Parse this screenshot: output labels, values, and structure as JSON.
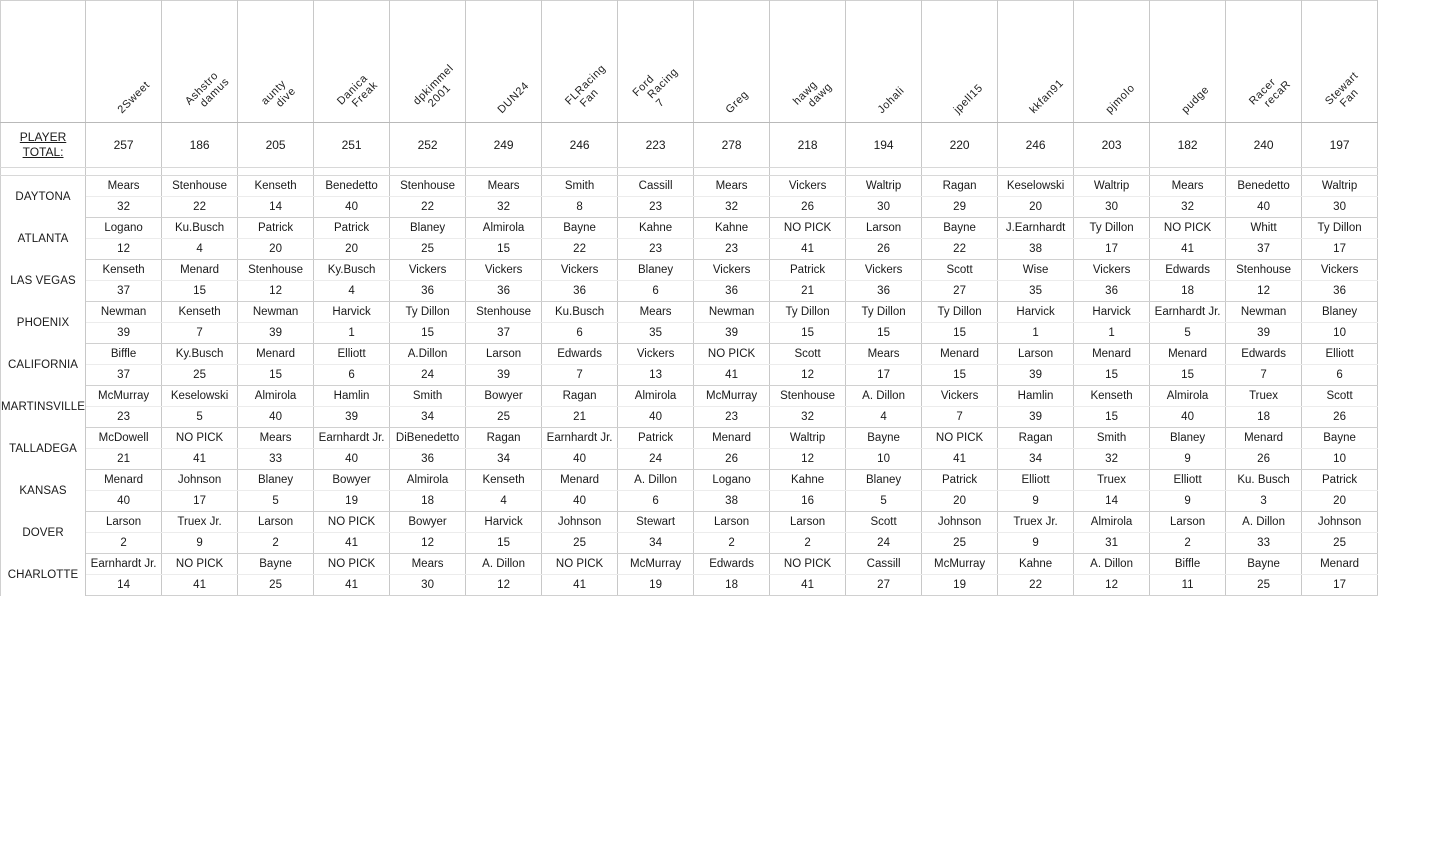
{
  "sheet": {
    "total_row_label": "PLAYER TOTAL:",
    "total_label_line1": "PLAYER",
    "total_label_line2": "TOTAL:",
    "corner_label": ""
  },
  "players": [
    {
      "name": "2Sweet",
      "lines": [
        "2Sweet"
      ],
      "total": "257"
    },
    {
      "name": "Ashstrodamus",
      "lines": [
        "Ashstro",
        "damus"
      ],
      "total": "186"
    },
    {
      "name": "aunty dive",
      "lines": [
        "aunty",
        "dive"
      ],
      "total": "205"
    },
    {
      "name": "Danica Freak",
      "lines": [
        "Danica",
        "Freak"
      ],
      "total": "251"
    },
    {
      "name": "dpkimmel 2001",
      "lines": [
        "dpkimmel",
        "2001"
      ],
      "total": "252"
    },
    {
      "name": "DUN24",
      "lines": [
        "DUN24"
      ],
      "total": "249"
    },
    {
      "name": "FLRacing Fan",
      "lines": [
        "FLRacing",
        "Fan"
      ],
      "total": "246"
    },
    {
      "name": "Ford Racing 7",
      "lines": [
        "Ford",
        "Racing",
        "7"
      ],
      "total": "223"
    },
    {
      "name": "Greg",
      "lines": [
        "Greg"
      ],
      "total": "278"
    },
    {
      "name": "hawg dawg",
      "lines": [
        "hawg",
        "dawg"
      ],
      "total": "218"
    },
    {
      "name": "Johali",
      "lines": [
        "Johali"
      ],
      "total": "194"
    },
    {
      "name": "jpell15",
      "lines": [
        "jpell15"
      ],
      "total": "220"
    },
    {
      "name": "kkfan91",
      "lines": [
        "kkfan91"
      ],
      "total": "246"
    },
    {
      "name": "pjmolo",
      "lines": [
        "pjmolo"
      ],
      "total": "203"
    },
    {
      "name": "pudge",
      "lines": [
        "pudge"
      ],
      "total": "182"
    },
    {
      "name": "Racer recaR",
      "lines": [
        "Racer",
        "recaR"
      ],
      "total": "240"
    },
    {
      "name": "Stewart Fan",
      "lines": [
        "Stewart",
        "Fan"
      ],
      "total": "197"
    }
  ],
  "races": [
    {
      "track": "DAYTONA",
      "picks": [
        "Mears",
        "Stenhouse",
        "Kenseth",
        "Benedetto",
        "Stenhouse",
        "Mears",
        "Smith",
        "Cassill",
        "Mears",
        "Vickers",
        "Waltrip",
        "Ragan",
        "Keselowski",
        "Waltrip",
        "Mears",
        "Benedetto",
        "Waltrip"
      ],
      "points": [
        "32",
        "22",
        "14",
        "40",
        "22",
        "32",
        "8",
        "23",
        "32",
        "26",
        "30",
        "29",
        "20",
        "30",
        "32",
        "40",
        "30"
      ]
    },
    {
      "track": "ATLANTA",
      "picks": [
        "Logano",
        "Ku.Busch",
        "Patrick",
        "Patrick",
        "Blaney",
        "Almirola",
        "Bayne",
        "Kahne",
        "Kahne",
        "NO PICK",
        "Larson",
        "Bayne",
        "J.Earnhardt",
        "Ty Dillon",
        "NO PICK",
        "Whitt",
        "Ty Dillon"
      ],
      "points": [
        "12",
        "4",
        "20",
        "20",
        "25",
        "15",
        "22",
        "23",
        "23",
        "41",
        "26",
        "22",
        "38",
        "17",
        "41",
        "37",
        "17"
      ]
    },
    {
      "track": "LAS VEGAS",
      "picks": [
        "Kenseth",
        "Menard",
        "Stenhouse",
        "Ky.Busch",
        "Vickers",
        "Vickers",
        "Vickers",
        "Blaney",
        "Vickers",
        "Patrick",
        "Vickers",
        "Scott",
        "Wise",
        "Vickers",
        "Edwards",
        "Stenhouse",
        "Vickers"
      ],
      "points": [
        "37",
        "15",
        "12",
        "4",
        "36",
        "36",
        "36",
        "6",
        "36",
        "21",
        "36",
        "27",
        "35",
        "36",
        "18",
        "12",
        "36"
      ]
    },
    {
      "track": "PHOENIX",
      "picks": [
        "Newman",
        "Kenseth",
        "Newman",
        "Harvick",
        "Ty Dillon",
        "Stenhouse",
        "Ku.Busch",
        "Mears",
        "Newman",
        "Ty Dillon",
        "Ty Dillon",
        "Ty Dillon",
        "Harvick",
        "Harvick",
        "Earnhardt Jr.",
        "Newman",
        "Blaney"
      ],
      "points": [
        "39",
        "7",
        "39",
        "1",
        "15",
        "37",
        "6",
        "35",
        "39",
        "15",
        "15",
        "15",
        "1",
        "1",
        "5",
        "39",
        "10"
      ]
    },
    {
      "track": "CALIFORNIA",
      "picks": [
        "Biffle",
        "Ky.Busch",
        "Menard",
        "Elliott",
        "A.Dillon",
        "Larson",
        "Edwards",
        "Vickers",
        "NO PICK",
        "Scott",
        "Mears",
        "Menard",
        "Larson",
        "Menard",
        "Menard",
        "Edwards",
        "Elliott"
      ],
      "points": [
        "37",
        "25",
        "15",
        "6",
        "24",
        "39",
        "7",
        "13",
        "41",
        "12",
        "17",
        "15",
        "39",
        "15",
        "15",
        "7",
        "6"
      ]
    },
    {
      "track": "MARTINSVILLE",
      "picks": [
        "McMurray",
        "Keselowski",
        "Almirola",
        "Hamlin",
        "Smith",
        "Bowyer",
        "Ragan",
        "Almirola",
        "McMurray",
        "Stenhouse",
        "A. Dillon",
        "Vickers",
        "Hamlin",
        "Kenseth",
        "Almirola",
        "Truex",
        "Scott"
      ],
      "points": [
        "23",
        "5",
        "40",
        "39",
        "34",
        "25",
        "21",
        "40",
        "23",
        "32",
        "4",
        "7",
        "39",
        "15",
        "40",
        "18",
        "26"
      ]
    },
    {
      "track": "TALLADEGA",
      "picks": [
        "McDowell",
        "NO PICK",
        "Mears",
        "Earnhardt Jr.",
        "DiBenedetto",
        "Ragan",
        "Earnhardt Jr.",
        "Patrick",
        "Menard",
        "Waltrip",
        "Bayne",
        "NO PICK",
        "Ragan",
        "Smith",
        "Blaney",
        "Menard",
        "Bayne"
      ],
      "points": [
        "21",
        "41",
        "33",
        "40",
        "36",
        "34",
        "40",
        "24",
        "26",
        "12",
        "10",
        "41",
        "34",
        "32",
        "9",
        "26",
        "10"
      ]
    },
    {
      "track": "KANSAS",
      "picks": [
        "Menard",
        "Johnson",
        "Blaney",
        "Bowyer",
        "Almirola",
        "Kenseth",
        "Menard",
        "A. Dillon",
        "Logano",
        "Kahne",
        "Blaney",
        "Patrick",
        "Elliott",
        "Truex",
        "Elliott",
        "Ku. Busch",
        "Patrick"
      ],
      "points": [
        "40",
        "17",
        "5",
        "19",
        "18",
        "4",
        "40",
        "6",
        "38",
        "16",
        "5",
        "20",
        "9",
        "14",
        "9",
        "3",
        "20"
      ]
    },
    {
      "track": "DOVER",
      "picks": [
        "Larson",
        "Truex Jr.",
        "Larson",
        "NO PICK",
        "Bowyer",
        "Harvick",
        "Johnson",
        "Stewart",
        "Larson",
        "Larson",
        "Scott",
        "Johnson",
        "Truex Jr.",
        "Almirola",
        "Larson",
        "A. Dillon",
        "Johnson"
      ],
      "points": [
        "2",
        "9",
        "2",
        "41",
        "12",
        "15",
        "25",
        "34",
        "2",
        "2",
        "24",
        "25",
        "9",
        "31",
        "2",
        "33",
        "25"
      ]
    },
    {
      "track": "CHARLOTTE",
      "picks": [
        "Earnhardt Jr.",
        "NO PICK",
        "Bayne",
        "NO PICK",
        "Mears",
        "A. Dillon",
        "NO PICK",
        "McMurray",
        "Edwards",
        "NO PICK",
        "Cassill",
        "McMurray",
        "Kahne",
        "A. Dillon",
        "Biffle",
        "Bayne",
        "Menard"
      ],
      "points": [
        "14",
        "41",
        "25",
        "41",
        "30",
        "12",
        "41",
        "19",
        "18",
        "41",
        "27",
        "19",
        "22",
        "12",
        "11",
        "25",
        "17"
      ]
    }
  ]
}
